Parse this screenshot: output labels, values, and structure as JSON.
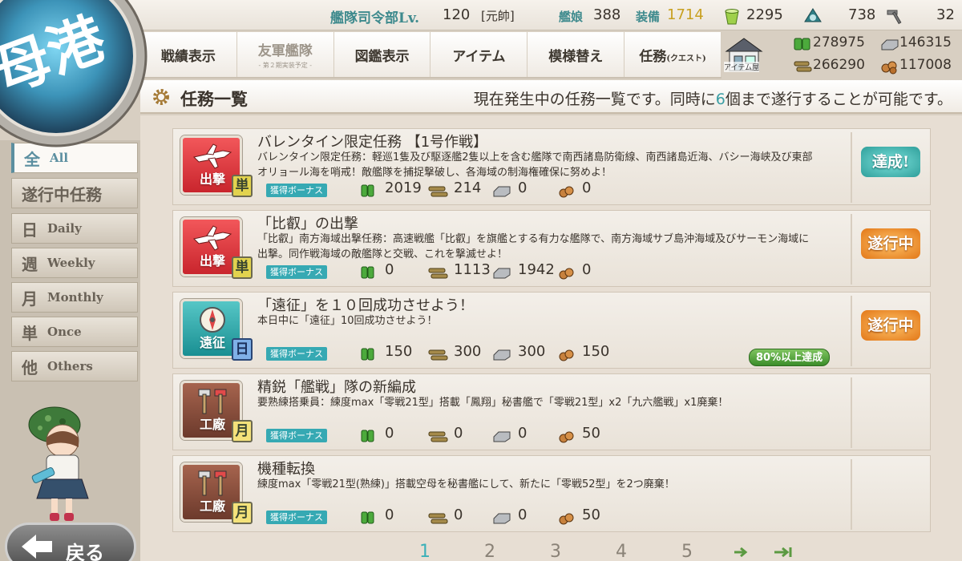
{
  "top": {
    "hq_label": "艦隊司令部Lv.",
    "hq_level": "120",
    "hq_rank": "[元帥]",
    "ships_label": "艦娘",
    "ships_count": "388",
    "equip_label": "装備",
    "equip_count": "1714",
    "bucket": "2295",
    "dev_material": "738",
    "screw": "32"
  },
  "menu": {
    "items": [
      {
        "label": "戦績表示"
      },
      {
        "label": "友軍艦隊",
        "sub": "- 第２期実装予定 -"
      },
      {
        "label": "図鑑表示"
      },
      {
        "label": "アイテム"
      },
      {
        "label": "模様替え"
      },
      {
        "label": "任務",
        "small": "(クエスト)"
      }
    ],
    "shop_label": "アイテム屋"
  },
  "resources": {
    "fuel": "278975",
    "steel": "146315",
    "ammo": "266290",
    "bauxite": "117008"
  },
  "header": {
    "title": "任務一覧",
    "msg_pre": "現在発生中の任務一覧です。同時に",
    "msg_num": "6",
    "msg_post": "個まで遂行することが可能です。"
  },
  "logo_text": "母港",
  "tabs": [
    {
      "kanji": "全",
      "en": "All"
    },
    {
      "kanji": "遂行中任務",
      "en": ""
    },
    {
      "kanji": "日",
      "en": "Daily"
    },
    {
      "kanji": "週",
      "en": "Weekly"
    },
    {
      "kanji": "月",
      "en": "Monthly"
    },
    {
      "kanji": "単",
      "en": "Once"
    },
    {
      "kanji": "他",
      "en": "Others"
    }
  ],
  "back_label": "戻る",
  "bonus_label": "獲得ボーナス",
  "quests": [
    {
      "category": "出撃",
      "freq": "単",
      "title": "バレンタイン限定任務 【1号作戦】",
      "desc": "バレンタイン限定任務：軽巡1隻及び駆逐艦2隻以上を含む艦隊で南西諸島防衛線、南西諸島近海、バシー海峡及び東部オリョール海を哨戒！敵艦隊を捕捉撃破し、各海域の制海権確保に努めよ！",
      "fuel": "2019",
      "ammo": "214",
      "steel": "0",
      "bauxite": "0",
      "status": "達成!"
    },
    {
      "category": "出撃",
      "freq": "単",
      "title": "「比叡」の出撃",
      "desc": "「比叡」南方海域出撃任務：高速戦艦「比叡」を旗艦とする有力な艦隊で、南方海域サブ島沖海域及びサーモン海域に出撃。同作戦海域の敵艦隊と交戦、これを撃滅せよ！",
      "fuel": "0",
      "ammo": "1113",
      "steel": "1942",
      "bauxite": "0",
      "status": "遂行中"
    },
    {
      "category": "遠征",
      "freq": "日",
      "title": "「遠征」を１０回成功させよう！",
      "desc": "本日中に「遠征」10回成功させよう！",
      "fuel": "150",
      "ammo": "300",
      "steel": "300",
      "bauxite": "150",
      "status": "遂行中",
      "progress": "80%以上達成"
    },
    {
      "category": "工廠",
      "freq": "月",
      "title": "精鋭「艦戦」隊の新編成",
      "desc": "要熟練搭乗員：練度max「零戦21型」搭載「鳳翔」秘書艦で「零戦21型」x2「九六艦戦」x1廃棄！",
      "fuel": "0",
      "ammo": "0",
      "steel": "0",
      "bauxite": "50",
      "status": ""
    },
    {
      "category": "工廠",
      "freq": "月",
      "title": "機種転換",
      "desc": "練度max「零戦21型(熟練)」搭載空母を秘書艦にして、新たに「零戦52型」を2つ廃棄！",
      "fuel": "0",
      "ammo": "0",
      "steel": "0",
      "bauxite": "50",
      "status": ""
    }
  ],
  "pager": {
    "pages": [
      "1",
      "2",
      "3",
      "4",
      "5"
    ],
    "current": "1"
  },
  "colors": {
    "accent": "#3ab0b8",
    "sortie": "#d93a3f",
    "expedition": "#27a3a5",
    "arsenal": "#8a4c3a",
    "done": "#2e9e9a",
    "in_progress": "#e27718"
  },
  "icons": [
    "gear-icon",
    "bucket-icon",
    "dev-material-icon",
    "screw-icon",
    "fuel-icon",
    "ammo-icon",
    "steel-icon",
    "bauxite-icon",
    "plane-icon",
    "compass-icon",
    "hammer-icon",
    "back-arrow-icon"
  ]
}
